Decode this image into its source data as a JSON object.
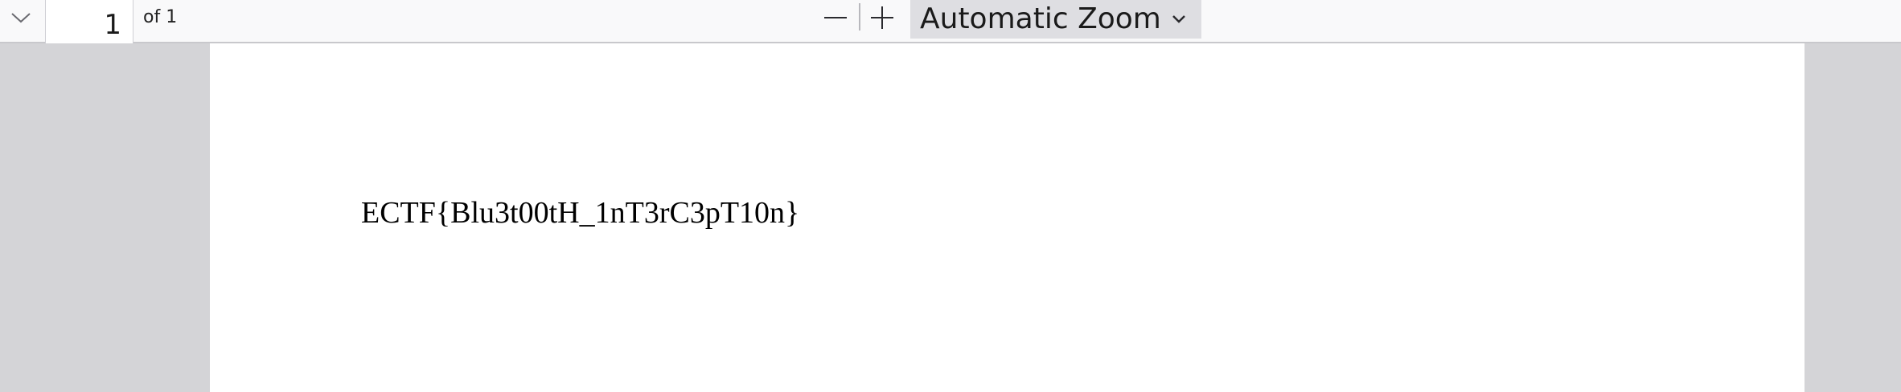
{
  "toolbar": {
    "next_page_icon": "chevron-down-icon",
    "page_number": "1",
    "page_count_label": "of 1",
    "zoom_out_icon": "minus-icon",
    "zoom_in_icon": "plus-icon",
    "zoom_value": "Automatic Zoom",
    "zoom_chevron_icon": "chevron-down-icon"
  },
  "document": {
    "text": "ECTF{Blu3t00tH_1nT3rC3pT10n}"
  },
  "colors": {
    "toolbar_bg": "#f9f9fa",
    "viewer_bg": "#d4d4d7",
    "zoom_select_bg": "#dedee2",
    "page_bg": "#ffffff"
  }
}
